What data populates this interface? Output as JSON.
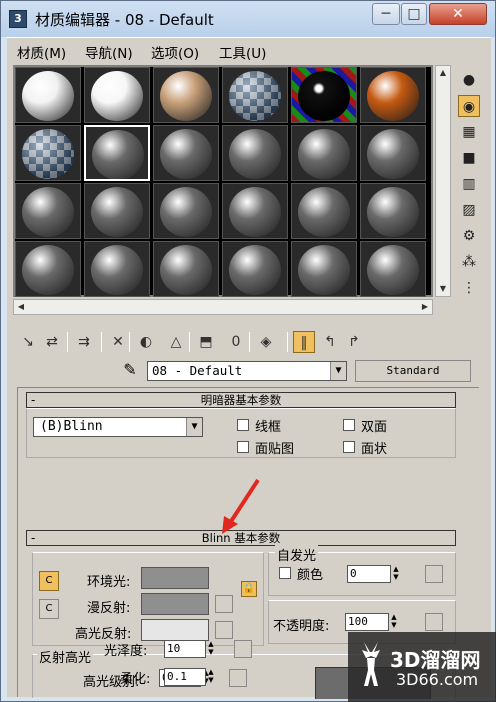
{
  "window": {
    "title": "材质编辑器 - 08 - Default",
    "minimize": "─",
    "maximize": "□",
    "close": "✕",
    "app_icon": "3"
  },
  "menubar": [
    "材质(M)",
    "导航(N)",
    "选项(O)",
    "工具(U)"
  ],
  "sample_slots": {
    "rows": 4,
    "cols": 6,
    "selected": 7,
    "colors": [
      [
        "#f2f2f2",
        "#f7f7f7",
        "#c8a07a",
        "checker",
        "#050505",
        "#c65a12"
      ],
      [
        "checker",
        "#6a6a6a",
        "#6a6a6a",
        "#6a6a6a",
        "#6a6a6a",
        "#6a6a6a"
      ],
      [
        "#6a6a6a",
        "#6a6a6a",
        "#6a6a6a",
        "#6a6a6a",
        "#6a6a6a",
        "#6a6a6a"
      ],
      [
        "#6a6a6a",
        "#6a6a6a",
        "#6a6a6a",
        "#6a6a6a",
        "#6a6a6a",
        "#6a6a6a"
      ]
    ]
  },
  "side_tools": [
    {
      "icon": "sample-type-icon",
      "glyph": "●"
    },
    {
      "icon": "backlight-icon",
      "glyph": "◉",
      "active": true
    },
    {
      "icon": "background-icon",
      "glyph": "▦"
    },
    {
      "icon": "uv-tiling-icon",
      "glyph": "■"
    },
    {
      "icon": "video-color-check-icon",
      "glyph": "▥"
    },
    {
      "icon": "make-preview-icon",
      "glyph": "▨"
    },
    {
      "icon": "options-icon",
      "glyph": "⚙"
    },
    {
      "icon": "select-by-material-icon",
      "glyph": "⁂"
    },
    {
      "icon": "material-navigator-icon",
      "glyph": "⋮"
    }
  ],
  "toolbar": [
    {
      "icon": "get-material-icon",
      "glyph": "↘"
    },
    {
      "icon": "put-to-scene-icon",
      "glyph": "⇄"
    },
    {
      "icon": "assign-to-selection-icon",
      "glyph": "⇉"
    },
    {
      "icon": "reset-map-icon",
      "glyph": "✕"
    },
    {
      "icon": "copy-material-icon",
      "glyph": "◐"
    },
    {
      "icon": "make-unique-icon",
      "glyph": "△"
    },
    {
      "icon": "put-to-library-icon",
      "glyph": "⬒"
    },
    {
      "icon": "material-effects-channel-icon",
      "glyph": "0"
    },
    {
      "icon": "show-map-in-viewport-icon",
      "glyph": "◈"
    },
    {
      "icon": "show-end-result-icon",
      "glyph": "‖",
      "active": true
    },
    {
      "icon": "go-to-parent-icon",
      "glyph": "↰"
    },
    {
      "icon": "go-forward-sibling-icon",
      "glyph": "↱"
    }
  ],
  "material": {
    "name": "08 - Default",
    "type": "Standard",
    "picker_icon": "✎"
  },
  "shader_rollout": {
    "title": "明暗器基本参数",
    "collapse": "-",
    "shader": "(B)Blinn",
    "wire": "线框",
    "two_sided": "双面",
    "face_map": "面贴图",
    "faceted": "面状"
  },
  "blinn_rollout": {
    "title": "Blinn 基本参数",
    "collapse": "-",
    "ambient_label": "环境光:",
    "diffuse_label": "漫反射:",
    "specular_label": "高光反射:",
    "ambient_color": "#8f8f8f",
    "diffuse_color": "#8f8f8f",
    "specular_color": "#e6e6e6",
    "self_illum_title": "自发光",
    "color_label": "颜色",
    "self_illum_value": "0",
    "opacity_label": "不透明度:",
    "opacity_value": "100",
    "lock_glyph": "🔒",
    "c_glyph": "C"
  },
  "specular_highlights": {
    "title": "反射高光",
    "level_label": "高光级别:",
    "level_value": "0",
    "gloss_label": "光泽度:",
    "gloss_value": "10",
    "soften_label": "柔化:",
    "soften_value": "0.1"
  },
  "watermark": {
    "line1": "3D溜溜网",
    "line2": "3D66.com"
  }
}
